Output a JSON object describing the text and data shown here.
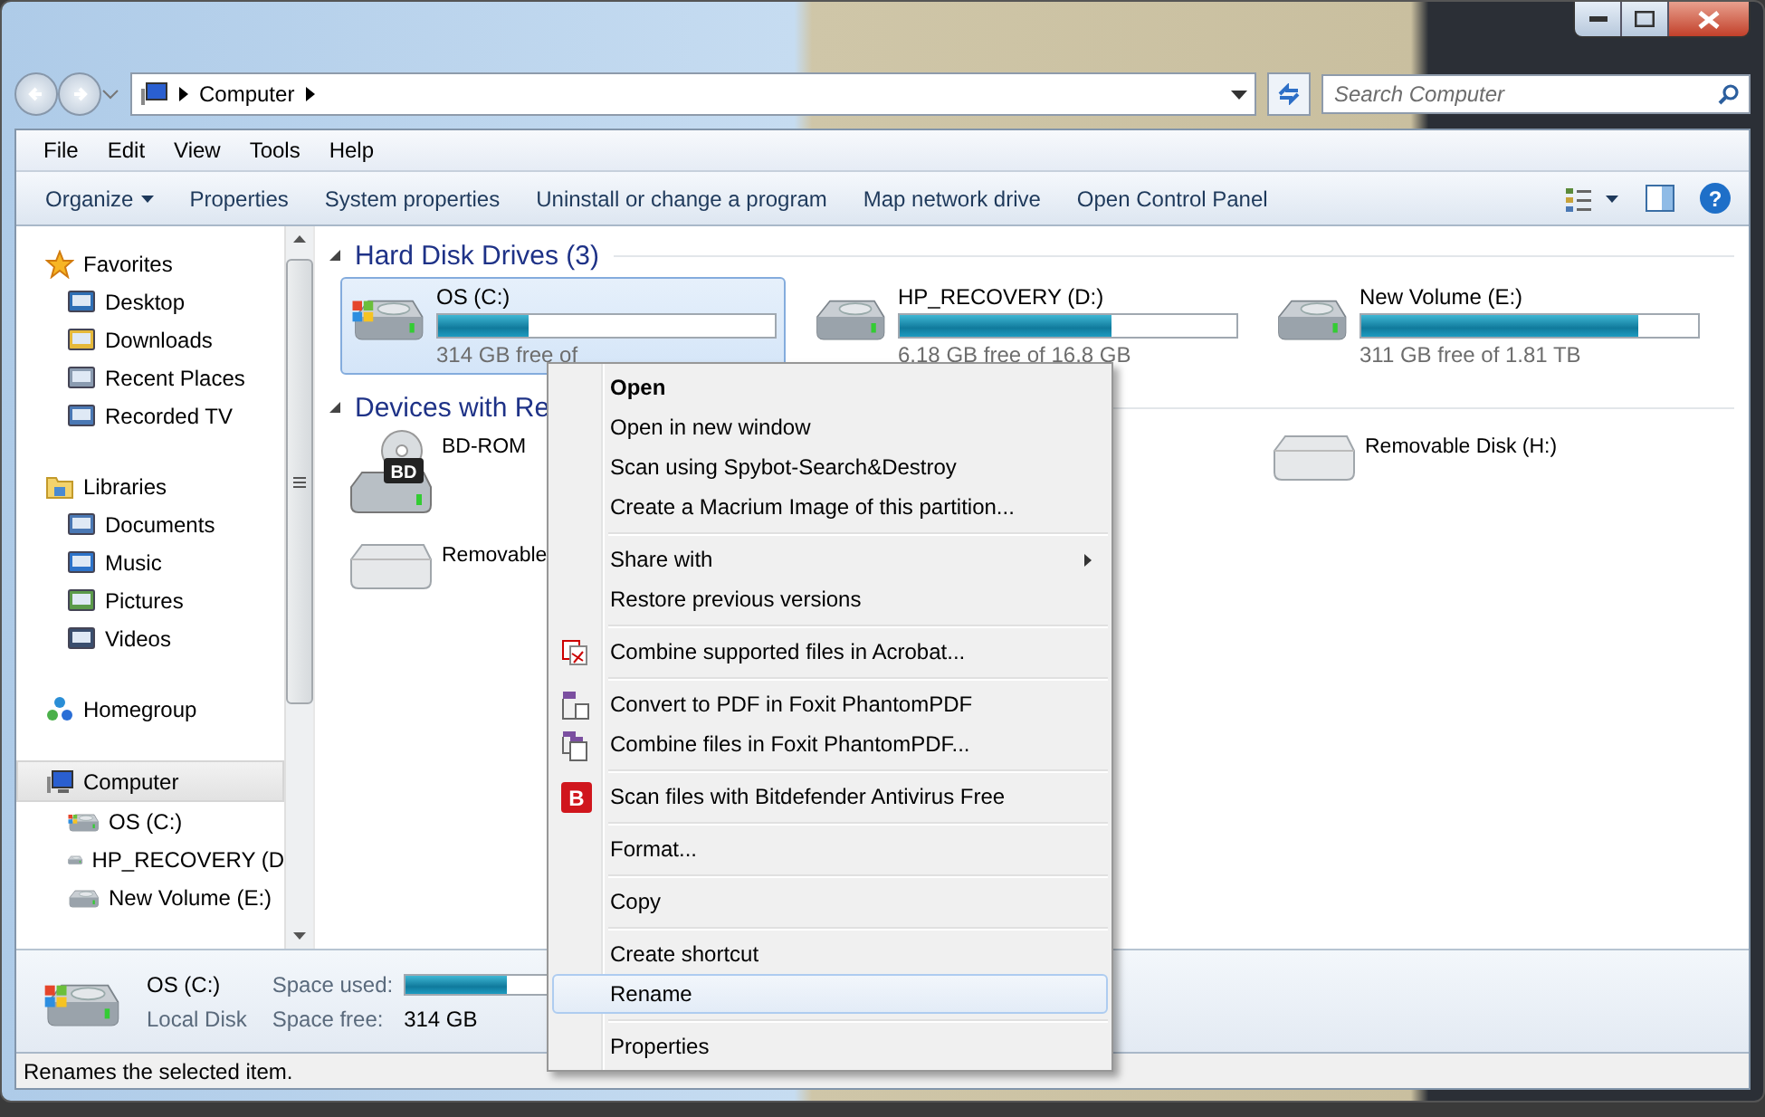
{
  "address_bar": {
    "path": "Computer"
  },
  "search": {
    "placeholder": "Search Computer"
  },
  "menu_bar": [
    "File",
    "Edit",
    "View",
    "Tools",
    "Help"
  ],
  "toolbar": [
    {
      "label": "Organize",
      "dropdown": true
    },
    {
      "label": "Properties",
      "dropdown": false
    },
    {
      "label": "System properties",
      "dropdown": false
    },
    {
      "label": "Uninstall or change a program",
      "dropdown": false
    },
    {
      "label": "Map network drive",
      "dropdown": false
    },
    {
      "label": "Open Control Panel",
      "dropdown": false
    }
  ],
  "sidebar": {
    "items": [
      {
        "label": "Favorites",
        "selected": false,
        "children": [
          {
            "label": "Desktop",
            "selected": false
          },
          {
            "label": "Downloads",
            "selected": false
          },
          {
            "label": "Recent Places",
            "selected": false
          },
          {
            "label": "Recorded TV",
            "selected": false
          }
        ]
      },
      {
        "label": "Libraries",
        "selected": false,
        "children": [
          {
            "label": "Documents",
            "selected": false
          },
          {
            "label": "Music",
            "selected": false
          },
          {
            "label": "Pictures",
            "selected": false
          },
          {
            "label": "Videos",
            "selected": false
          }
        ]
      },
      {
        "label": "Homegroup",
        "selected": false
      },
      {
        "label": "Computer",
        "selected": true,
        "children": [
          {
            "label": "OS (C:)",
            "selected": false
          },
          {
            "label": "HP_RECOVERY (D",
            "selected": false
          },
          {
            "label": "New Volume (E:)",
            "selected": false
          }
        ]
      }
    ]
  },
  "sections": [
    {
      "title": "Hard Disk Drives (3)",
      "expanded": true,
      "kind": "drives",
      "items": [
        {
          "name": "OS (C:)",
          "level": 0.27,
          "free": "314 GB free of",
          "selected": true,
          "system": true
        },
        {
          "name": "HP_RECOVERY (D:)",
          "level": 0.63,
          "free": "6.18 GB free of 16.8 GB",
          "selected": false,
          "system": false
        },
        {
          "name": "New Volume (E:)",
          "level": 0.82,
          "free": "311 GB free of 1.81 TB",
          "selected": false,
          "system": false
        }
      ]
    },
    {
      "title": "Devices with Re",
      "expanded": true,
      "kind": "devices",
      "items": [
        {
          "name": "BD-ROM",
          "kind": "optical",
          "disc_label": "BD"
        },
        {
          "name": "Removable Disk (H:)",
          "kind": "removable"
        },
        {
          "name": "Removable",
          "kind": "removable"
        }
      ]
    }
  ],
  "help_icon": "?",
  "details": {
    "name": "OS (C:)",
    "type": "Local Disk",
    "used_label": "Space used:",
    "level": 0.4,
    "free_label": "Space free:",
    "free": "314 GB"
  },
  "status_bar": "Renames the selected item.",
  "context_menu": [
    [
      {
        "label": "Open",
        "kind": "plain",
        "default": true,
        "submenu": false,
        "selected": false
      },
      {
        "label": "Open in new window",
        "kind": "plain",
        "default": false,
        "submenu": false,
        "selected": false
      },
      {
        "label": "Scan using Spybot-Search&Destroy",
        "kind": "plain",
        "default": false,
        "submenu": false,
        "selected": false
      },
      {
        "label": "Create a Macrium Image of this partition...",
        "kind": "plain",
        "default": false,
        "submenu": false,
        "selected": false
      }
    ],
    [
      {
        "label": "Share with",
        "kind": "plain",
        "default": false,
        "submenu": true,
        "selected": false
      },
      {
        "label": "Restore previous versions",
        "kind": "plain",
        "default": false,
        "submenu": false,
        "selected": false
      }
    ],
    [
      {
        "label": "Combine supported files in Acrobat...",
        "kind": "acrobat",
        "default": false,
        "submenu": false,
        "selected": false
      }
    ],
    [
      {
        "label": "Convert to PDF in Foxit PhantomPDF",
        "kind": "foxit-convert",
        "default": false,
        "submenu": false,
        "selected": false
      },
      {
        "label": "Combine files in Foxit PhantomPDF...",
        "kind": "foxit-combine",
        "default": false,
        "submenu": false,
        "selected": false
      }
    ],
    [
      {
        "label": "Scan files with Bitdefender Antivirus Free",
        "kind": "bitdefender",
        "badge": "B",
        "default": false,
        "submenu": false,
        "selected": false
      }
    ],
    [
      {
        "label": "Format...",
        "kind": "plain",
        "default": false,
        "submenu": false,
        "selected": false
      }
    ],
    [
      {
        "label": "Copy",
        "kind": "plain",
        "default": false,
        "submenu": false,
        "selected": false
      }
    ],
    [
      {
        "label": "Create shortcut",
        "kind": "plain",
        "default": false,
        "submenu": false,
        "selected": false
      },
      {
        "label": "Rename",
        "kind": "plain",
        "default": false,
        "submenu": false,
        "selected": true
      }
    ],
    [
      {
        "label": "Properties",
        "kind": "plain",
        "default": false,
        "submenu": false,
        "selected": false
      }
    ]
  ]
}
